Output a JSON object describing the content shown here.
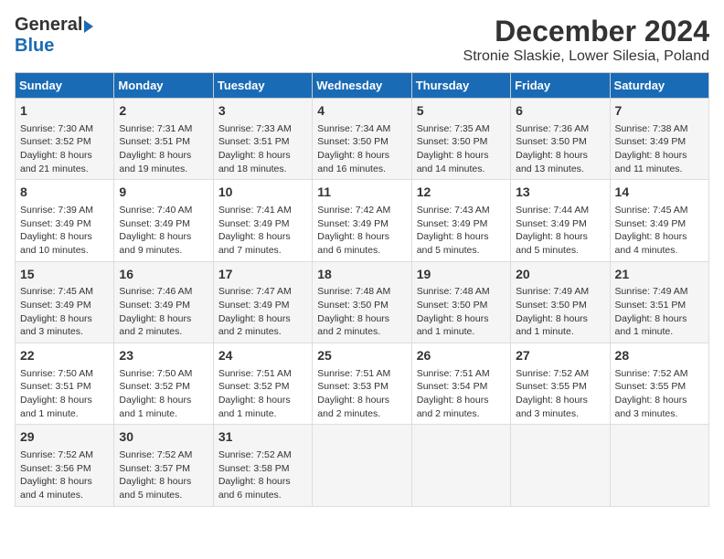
{
  "header": {
    "logo_general": "General",
    "logo_blue": "Blue",
    "title": "December 2024",
    "subtitle": "Stronie Slaskie, Lower Silesia, Poland"
  },
  "days_of_week": [
    "Sunday",
    "Monday",
    "Tuesday",
    "Wednesday",
    "Thursday",
    "Friday",
    "Saturday"
  ],
  "weeks": [
    [
      {
        "day": "1",
        "sunrise": "Sunrise: 7:30 AM",
        "sunset": "Sunset: 3:52 PM",
        "daylight": "Daylight: 8 hours and 21 minutes."
      },
      {
        "day": "2",
        "sunrise": "Sunrise: 7:31 AM",
        "sunset": "Sunset: 3:51 PM",
        "daylight": "Daylight: 8 hours and 19 minutes."
      },
      {
        "day": "3",
        "sunrise": "Sunrise: 7:33 AM",
        "sunset": "Sunset: 3:51 PM",
        "daylight": "Daylight: 8 hours and 18 minutes."
      },
      {
        "day": "4",
        "sunrise": "Sunrise: 7:34 AM",
        "sunset": "Sunset: 3:50 PM",
        "daylight": "Daylight: 8 hours and 16 minutes."
      },
      {
        "day": "5",
        "sunrise": "Sunrise: 7:35 AM",
        "sunset": "Sunset: 3:50 PM",
        "daylight": "Daylight: 8 hours and 14 minutes."
      },
      {
        "day": "6",
        "sunrise": "Sunrise: 7:36 AM",
        "sunset": "Sunset: 3:50 PM",
        "daylight": "Daylight: 8 hours and 13 minutes."
      },
      {
        "day": "7",
        "sunrise": "Sunrise: 7:38 AM",
        "sunset": "Sunset: 3:49 PM",
        "daylight": "Daylight: 8 hours and 11 minutes."
      }
    ],
    [
      {
        "day": "8",
        "sunrise": "Sunrise: 7:39 AM",
        "sunset": "Sunset: 3:49 PM",
        "daylight": "Daylight: 8 hours and 10 minutes."
      },
      {
        "day": "9",
        "sunrise": "Sunrise: 7:40 AM",
        "sunset": "Sunset: 3:49 PM",
        "daylight": "Daylight: 8 hours and 9 minutes."
      },
      {
        "day": "10",
        "sunrise": "Sunrise: 7:41 AM",
        "sunset": "Sunset: 3:49 PM",
        "daylight": "Daylight: 8 hours and 7 minutes."
      },
      {
        "day": "11",
        "sunrise": "Sunrise: 7:42 AM",
        "sunset": "Sunset: 3:49 PM",
        "daylight": "Daylight: 8 hours and 6 minutes."
      },
      {
        "day": "12",
        "sunrise": "Sunrise: 7:43 AM",
        "sunset": "Sunset: 3:49 PM",
        "daylight": "Daylight: 8 hours and 5 minutes."
      },
      {
        "day": "13",
        "sunrise": "Sunrise: 7:44 AM",
        "sunset": "Sunset: 3:49 PM",
        "daylight": "Daylight: 8 hours and 5 minutes."
      },
      {
        "day": "14",
        "sunrise": "Sunrise: 7:45 AM",
        "sunset": "Sunset: 3:49 PM",
        "daylight": "Daylight: 8 hours and 4 minutes."
      }
    ],
    [
      {
        "day": "15",
        "sunrise": "Sunrise: 7:45 AM",
        "sunset": "Sunset: 3:49 PM",
        "daylight": "Daylight: 8 hours and 3 minutes."
      },
      {
        "day": "16",
        "sunrise": "Sunrise: 7:46 AM",
        "sunset": "Sunset: 3:49 PM",
        "daylight": "Daylight: 8 hours and 2 minutes."
      },
      {
        "day": "17",
        "sunrise": "Sunrise: 7:47 AM",
        "sunset": "Sunset: 3:49 PM",
        "daylight": "Daylight: 8 hours and 2 minutes."
      },
      {
        "day": "18",
        "sunrise": "Sunrise: 7:48 AM",
        "sunset": "Sunset: 3:50 PM",
        "daylight": "Daylight: 8 hours and 2 minutes."
      },
      {
        "day": "19",
        "sunrise": "Sunrise: 7:48 AM",
        "sunset": "Sunset: 3:50 PM",
        "daylight": "Daylight: 8 hours and 1 minute."
      },
      {
        "day": "20",
        "sunrise": "Sunrise: 7:49 AM",
        "sunset": "Sunset: 3:50 PM",
        "daylight": "Daylight: 8 hours and 1 minute."
      },
      {
        "day": "21",
        "sunrise": "Sunrise: 7:49 AM",
        "sunset": "Sunset: 3:51 PM",
        "daylight": "Daylight: 8 hours and 1 minute."
      }
    ],
    [
      {
        "day": "22",
        "sunrise": "Sunrise: 7:50 AM",
        "sunset": "Sunset: 3:51 PM",
        "daylight": "Daylight: 8 hours and 1 minute."
      },
      {
        "day": "23",
        "sunrise": "Sunrise: 7:50 AM",
        "sunset": "Sunset: 3:52 PM",
        "daylight": "Daylight: 8 hours and 1 minute."
      },
      {
        "day": "24",
        "sunrise": "Sunrise: 7:51 AM",
        "sunset": "Sunset: 3:52 PM",
        "daylight": "Daylight: 8 hours and 1 minute."
      },
      {
        "day": "25",
        "sunrise": "Sunrise: 7:51 AM",
        "sunset": "Sunset: 3:53 PM",
        "daylight": "Daylight: 8 hours and 2 minutes."
      },
      {
        "day": "26",
        "sunrise": "Sunrise: 7:51 AM",
        "sunset": "Sunset: 3:54 PM",
        "daylight": "Daylight: 8 hours and 2 minutes."
      },
      {
        "day": "27",
        "sunrise": "Sunrise: 7:52 AM",
        "sunset": "Sunset: 3:55 PM",
        "daylight": "Daylight: 8 hours and 3 minutes."
      },
      {
        "day": "28",
        "sunrise": "Sunrise: 7:52 AM",
        "sunset": "Sunset: 3:55 PM",
        "daylight": "Daylight: 8 hours and 3 minutes."
      }
    ],
    [
      {
        "day": "29",
        "sunrise": "Sunrise: 7:52 AM",
        "sunset": "Sunset: 3:56 PM",
        "daylight": "Daylight: 8 hours and 4 minutes."
      },
      {
        "day": "30",
        "sunrise": "Sunrise: 7:52 AM",
        "sunset": "Sunset: 3:57 PM",
        "daylight": "Daylight: 8 hours and 5 minutes."
      },
      {
        "day": "31",
        "sunrise": "Sunrise: 7:52 AM",
        "sunset": "Sunset: 3:58 PM",
        "daylight": "Daylight: 8 hours and 6 minutes."
      },
      null,
      null,
      null,
      null
    ]
  ]
}
